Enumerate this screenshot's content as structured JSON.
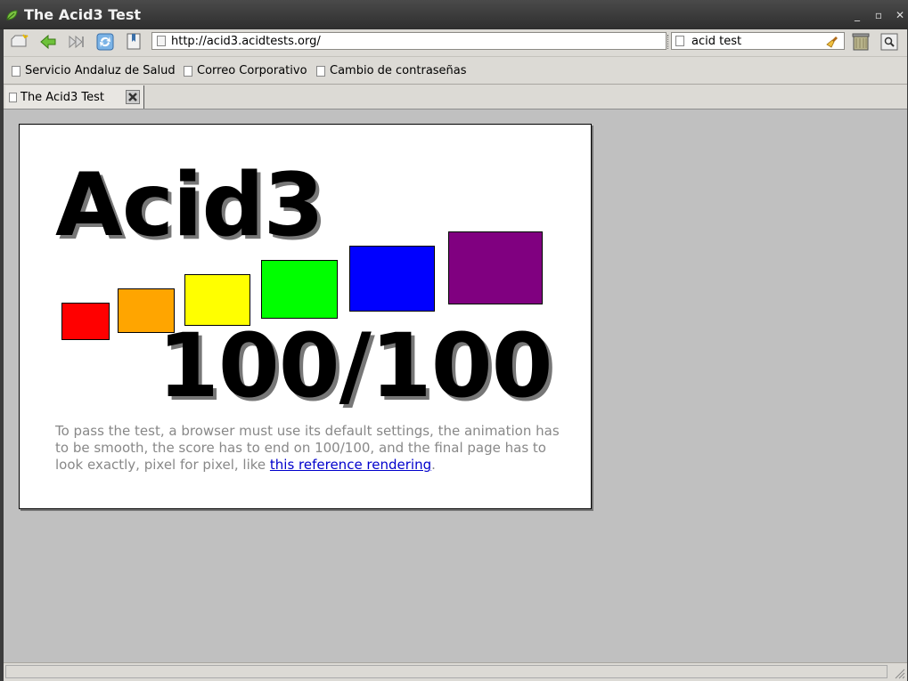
{
  "window": {
    "title": "The Acid3 Test",
    "controls": {
      "minimize": "_",
      "maximize": "▫",
      "close": "✕"
    }
  },
  "navbar": {
    "url": "http://acid3.acidtests.org/",
    "search_value": "acid test"
  },
  "bookmarks": [
    {
      "label": "Servicio Andaluz de Salud"
    },
    {
      "label": "Correo Corporativo"
    },
    {
      "label": "Cambio de contraseñas"
    }
  ],
  "tab": {
    "label": "The Acid3 Test"
  },
  "page": {
    "title": "Acid3",
    "score": "100/100",
    "description": "To pass the test, a browser must use its default settings, the animation has to be smooth, the score has to end on 100/100, and the final page has to look exactly, pixel for pixel, like ",
    "link_text": "this reference rendering",
    "trailing": ".",
    "squares": [
      {
        "name": "red-square",
        "color": "#ff0000"
      },
      {
        "name": "orange-square",
        "color": "#ffa500"
      },
      {
        "name": "yellow-square",
        "color": "#ffff00"
      },
      {
        "name": "lime-square",
        "color": "#00ff00"
      },
      {
        "name": "blue-square",
        "color": "#0000ff"
      },
      {
        "name": "purple-square",
        "color": "#800080"
      }
    ]
  }
}
